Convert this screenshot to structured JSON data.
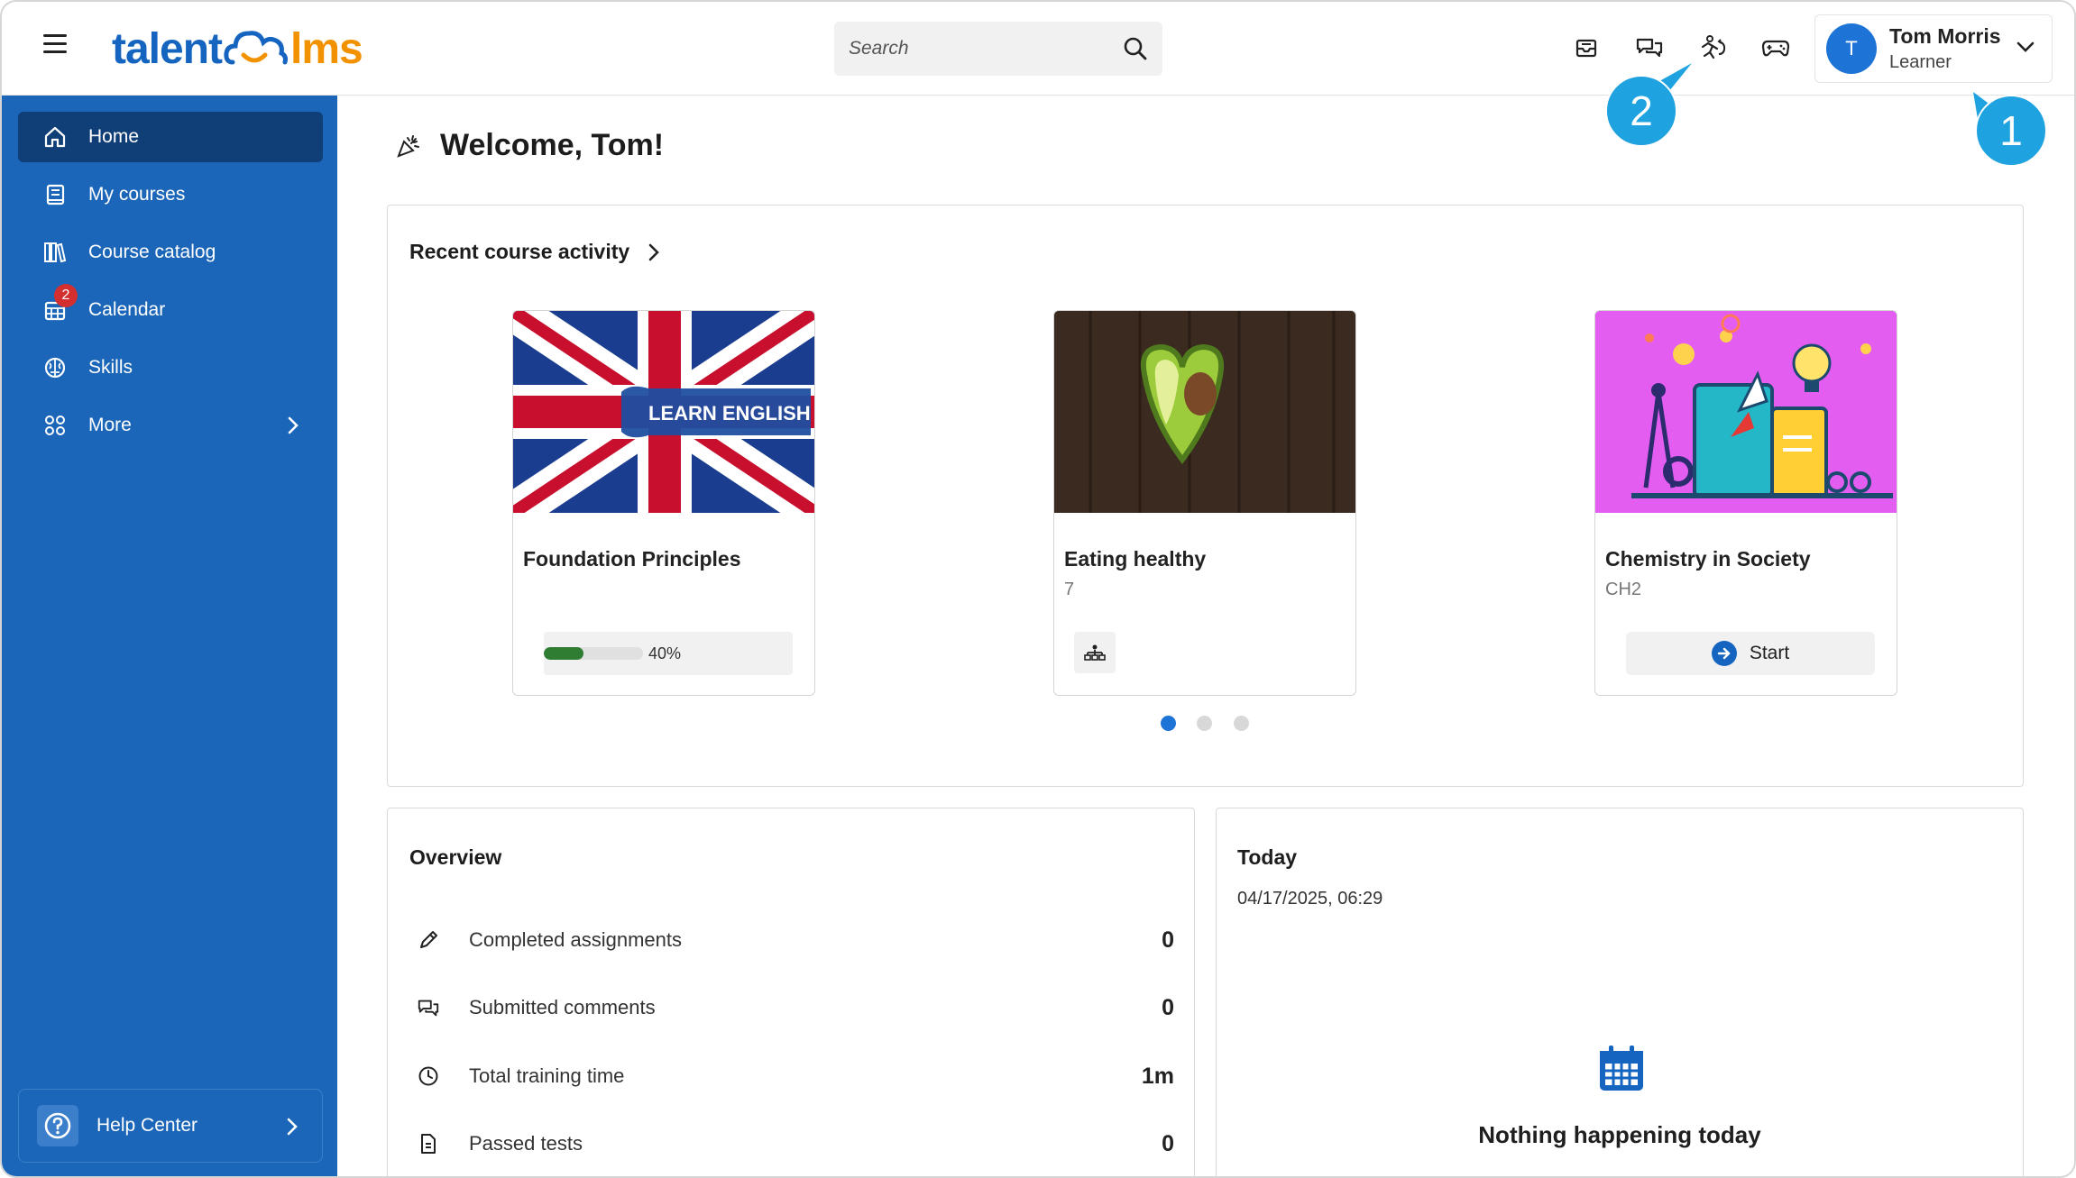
{
  "header": {
    "logo_part1": "talent",
    "logo_part2": "lms",
    "search_placeholder": "Search",
    "user_initial": "T",
    "user_name": "Tom Morris",
    "user_role": "Learner"
  },
  "sidebar": {
    "items": [
      {
        "label": "Home"
      },
      {
        "label": "My courses"
      },
      {
        "label": "Course catalog"
      },
      {
        "label": "Calendar",
        "badge": "2"
      },
      {
        "label": "Skills"
      },
      {
        "label": "More"
      }
    ],
    "help_label": "Help Center"
  },
  "main": {
    "welcome": "Welcome, Tom!",
    "recent_title": "Recent course activity",
    "courses": [
      {
        "title": "Foundation Principles",
        "subtitle": "",
        "progress": 40,
        "progress_label": "40%",
        "thumb_text": "LEARN ENGLISH"
      },
      {
        "title": "Eating healthy",
        "subtitle": "7"
      },
      {
        "title": "Chemistry in Society",
        "subtitle": "CH2",
        "action": "Start"
      }
    ],
    "overview": {
      "title": "Overview",
      "rows": [
        {
          "label": "Completed assignments",
          "value": "0"
        },
        {
          "label": "Submitted comments",
          "value": "0"
        },
        {
          "label": "Total training time",
          "value": "1m"
        },
        {
          "label": "Passed tests",
          "value": "0"
        }
      ]
    },
    "today": {
      "title": "Today",
      "datetime": "04/17/2025, 06:29",
      "empty_text": "Nothing happening today"
    }
  },
  "callouts": {
    "one": "1",
    "two": "2"
  },
  "colors": {
    "brand_blue": "#1b66b8",
    "brand_orange": "#f39200",
    "active_nav": "#103f78",
    "callout": "#1ea2e0"
  }
}
